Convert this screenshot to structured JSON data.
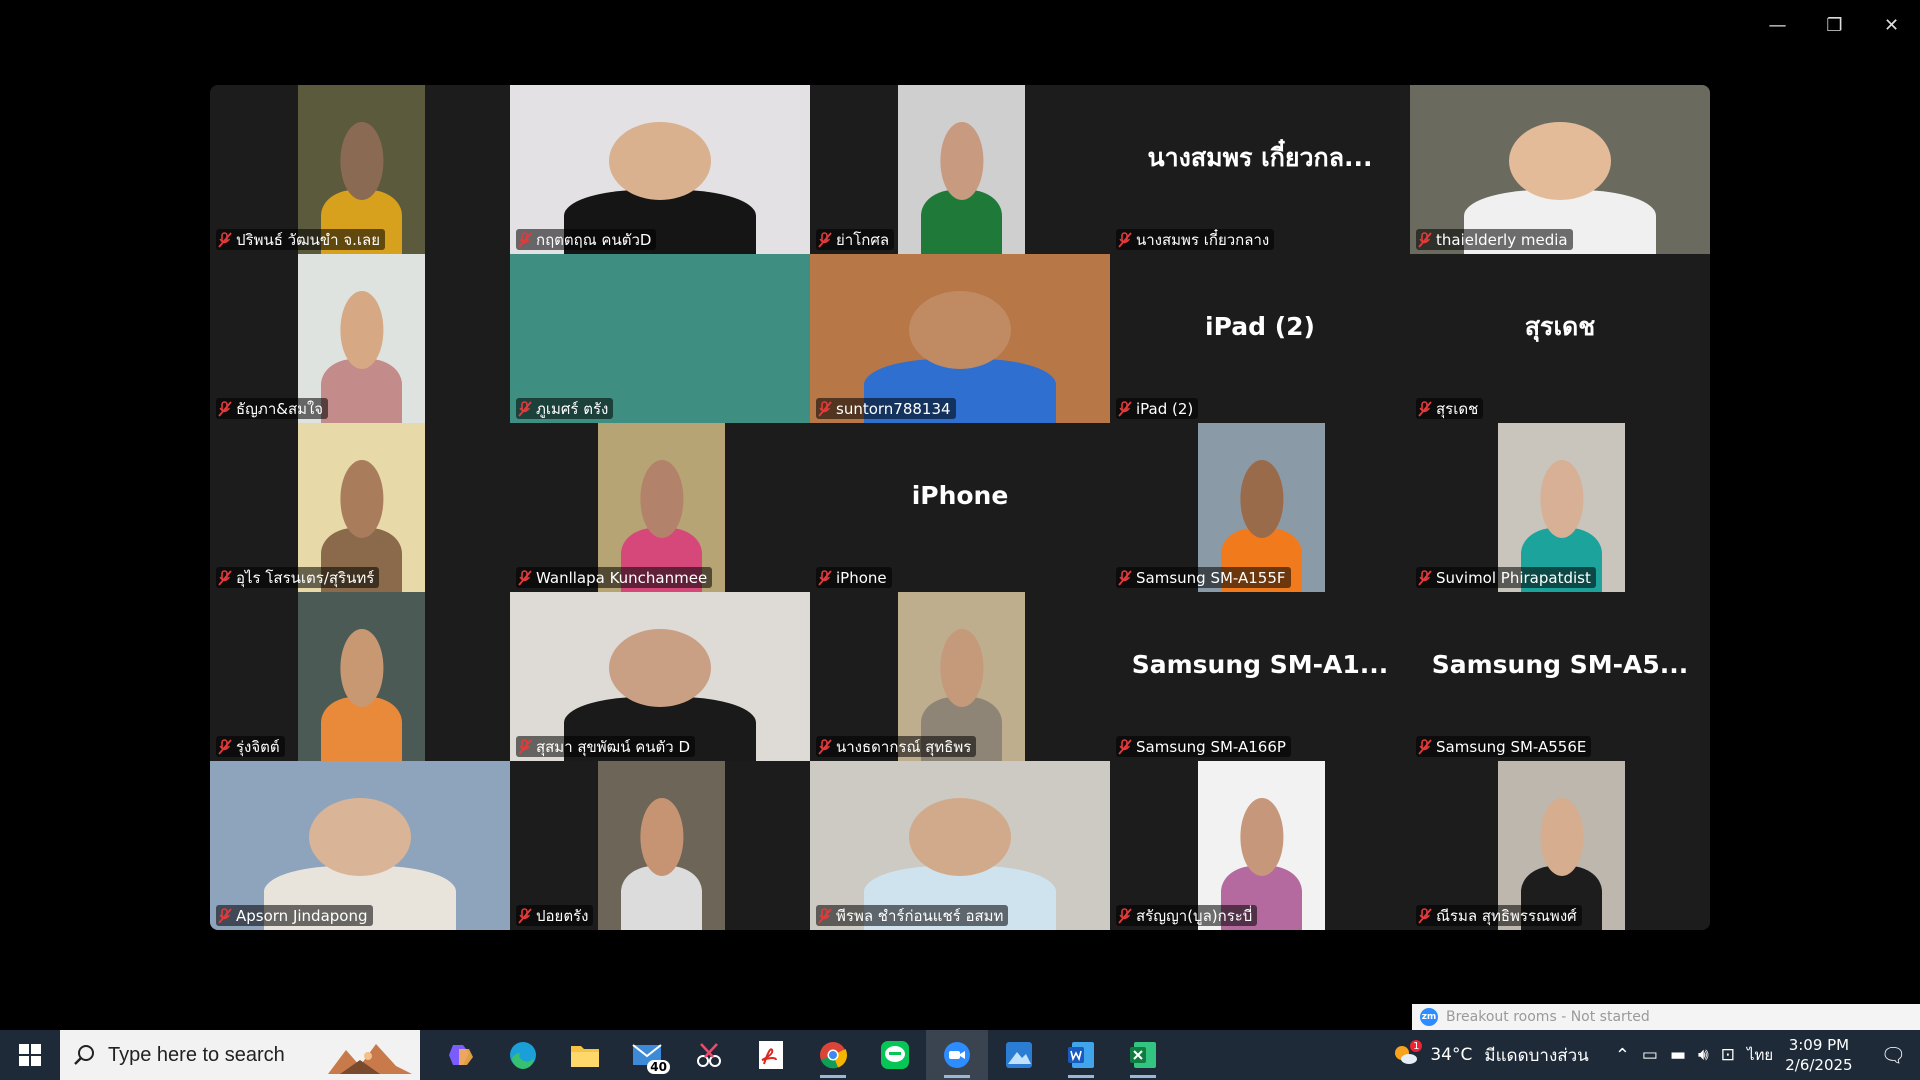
{
  "window": {
    "minimize": "—",
    "restore": "❐",
    "close": "✕"
  },
  "participants": [
    {
      "name": "ปริพนธ์ วัฒนขำ จ.เลย",
      "video": "narrow",
      "bg": "#5b5a3c",
      "face": "#8a6a52",
      "shirt": "#d7a11e"
    },
    {
      "name": "กฤตตฤณ คนตัวD",
      "video": "full",
      "bg": "#e4e1e5",
      "face": "#d9b18e",
      "shirt": "#151515",
      "active": true
    },
    {
      "name": "ย่าโกศล",
      "video": "narrow",
      "bg": "#cfcfcf",
      "face": "#c89a80",
      "shirt": "#1f7a3a"
    },
    {
      "name": "นางสมพร เกี๋ยวกลาง",
      "display_name": "นางสมพร เกี๋ยวกล...",
      "video": "none"
    },
    {
      "name": "thaielderly media",
      "video": "full",
      "bg": "#6a6b5e",
      "face": "#e3bb98",
      "shirt": "#f0f0f0"
    },
    {
      "name": "ธัญภา&สมใจ",
      "video": "narrow",
      "bg": "#dfe3e0",
      "face": "#d6a984",
      "shirt": "#c48b8b"
    },
    {
      "name": "ภูเมศร์ ตรัง",
      "video": "full",
      "bg": "#3e8f82",
      "face": "#3e8f82",
      "shirt": "#3e8f82"
    },
    {
      "name": "suntorn788134",
      "video": "full",
      "bg": "#b77747",
      "face": "#c08a62",
      "shirt": "#2e6fd0"
    },
    {
      "name": "iPad (2)",
      "display_name": "iPad (2)",
      "video": "none"
    },
    {
      "name": "สุรเดช",
      "display_name": "สุรเดช",
      "video": "none"
    },
    {
      "name": "อุไร โสรนเตร/สุรินทร์",
      "video": "narrow",
      "bg": "#e7d9a8",
      "face": "#a97c5b",
      "shirt": "#8a6a4a"
    },
    {
      "name": "Wanllapa Kunchanmee",
      "video": "narrow",
      "bg": "#b7a474",
      "face": "#b3826a",
      "shirt": "#d6487a"
    },
    {
      "name": "iPhone",
      "display_name": "iPhone",
      "video": "none"
    },
    {
      "name": "Samsung SM-A155F",
      "video": "narrow",
      "bg": "#8a9aa6",
      "face": "#9a6b4b",
      "shirt": "#f07a1c"
    },
    {
      "name": "Suvimol Phirapatdist",
      "video": "narrow",
      "bg": "#c9c5bd",
      "face": "#d7b096",
      "shirt": "#1ba39c"
    },
    {
      "name": "รุ่งจิตต์",
      "video": "narrow",
      "bg": "#4c5a55",
      "face": "#c89873",
      "shirt": "#e88a3a"
    },
    {
      "name": "สุสมา สุขพัฒน์ คนตัว D",
      "video": "full",
      "bg": "#dedbd6",
      "face": "#caa085",
      "shirt": "#1a1a1a"
    },
    {
      "name": "นางธดากรณ์ สุทธิพร",
      "video": "narrow",
      "bg": "#bfae8e",
      "face": "#c49a7b",
      "shirt": "#8f8576"
    },
    {
      "name": "Samsung SM-A166P",
      "display_name": "Samsung  SM-A1...",
      "video": "none"
    },
    {
      "name": "Samsung SM-A556E",
      "display_name": "Samsung  SM-A5...",
      "video": "none"
    },
    {
      "name": "Apsorn Jindapong",
      "video": "full",
      "bg": "#8ea3bc",
      "face": "#d9b497",
      "shirt": "#e8e4dc"
    },
    {
      "name": "ปอยตรัง",
      "video": "narrow",
      "bg": "#6d6558",
      "face": "#c79473",
      "shirt": "#dcdcdc"
    },
    {
      "name": "พีรพล ชำร์ก่อนแชร์ อสมท",
      "video": "full",
      "bg": "#cdcac4",
      "face": "#d1aa8b",
      "shirt": "#cfe3ef"
    },
    {
      "name": "สรัญญา(บูล)กระบี่",
      "video": "narrow",
      "bg": "#f2f2f2",
      "face": "#c6977a",
      "shirt": "#b46a9f"
    },
    {
      "name": "ณีรมล สุทธิพรรณพงศ์",
      "video": "narrow",
      "bg": "#bdb7ae",
      "face": "#d6ad8f",
      "shirt": "#1d1d1d"
    }
  ],
  "breakout": {
    "logo": "zm",
    "text": "Breakout rooms - Not started"
  },
  "taskbar": {
    "search_placeholder": "Type here to search",
    "mail_badge": "40",
    "weather_temp": "34°C",
    "weather_text": "มีแดดบางส่วน",
    "weather_alert": "1",
    "language": "ไทย",
    "time": "3:09 PM",
    "date": "2/6/2025"
  },
  "colors": {
    "active_speaker": "#23d160",
    "mic_muted": "#e23b3b",
    "taskbar": "#1f2a38"
  }
}
